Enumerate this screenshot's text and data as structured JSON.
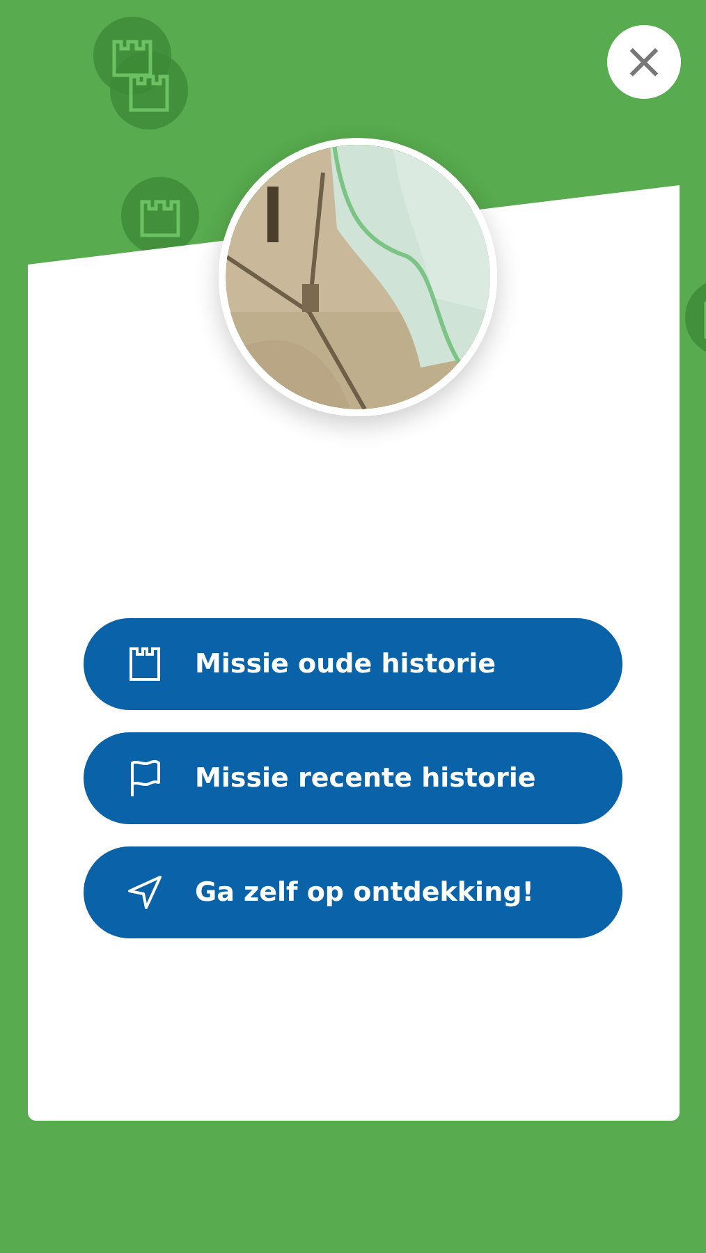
{
  "close_button": {
    "label": "×"
  },
  "actions": [
    {
      "label": "Missie oude historie",
      "kind": "castle"
    },
    {
      "label": "Missie recente historie",
      "kind": "flag"
    },
    {
      "label": "Ga zelf op ontdekking!",
      "kind": "navigate"
    }
  ]
}
